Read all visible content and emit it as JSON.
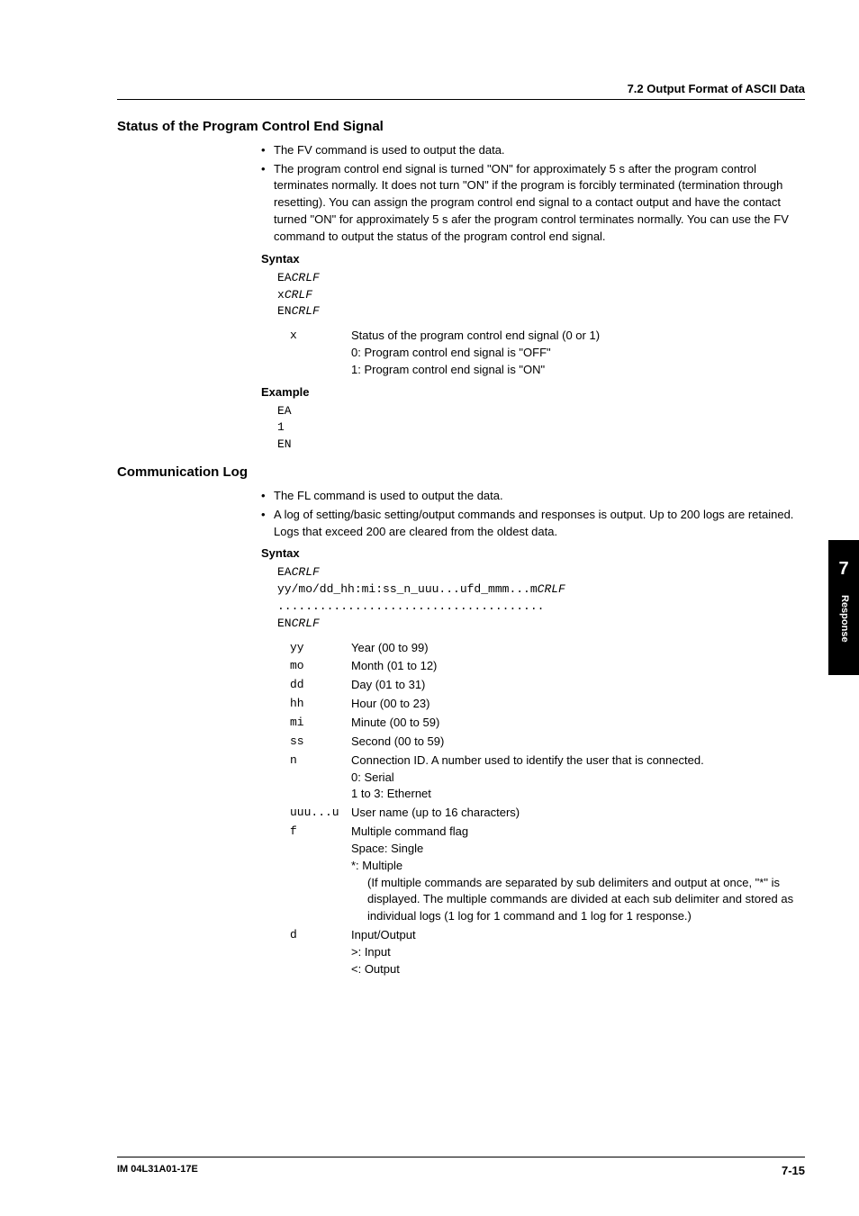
{
  "header": {
    "section": "7.2  Output Format of ASCII Data"
  },
  "sec1": {
    "title": "Status of the Program Control End Signal",
    "bullets": [
      "The FV  command is used to output the data.",
      "The program control end signal is turned \"ON\" for approximately 5 s after the program control terminates normally.  It does not turn \"ON\" if the program is forcibly terminated (termination through resetting).  You can assign the program control end signal to a contact output and have the contact turned \"ON\" for approximately 5 s afer the program control terminates normally.  You can use the FV command to output the status of the program control end signal."
    ],
    "syntax_label": "Syntax",
    "syntax_lines": {
      "l1a": "EA",
      "l1b": "CRLF",
      "l2a": "x",
      "l2b": "CRLF",
      "l3a": "EN",
      "l3b": "CRLF"
    },
    "params": [
      {
        "key": "x",
        "val": "Status of the program control end signal (0 or 1)",
        "sub": [
          "0: Program control end signal is \"OFF\"",
          "1: Program control end signal is \"ON\""
        ]
      }
    ],
    "example_label": "Example",
    "example_lines": [
      "EA",
      "1",
      "EN"
    ]
  },
  "sec2": {
    "title": "Communication Log",
    "bullets": [
      "The FL command is used to output the data.",
      "A log of setting/basic setting/output commands and responses is output.  Up to 200 logs are retained.  Logs that exceed 200 are cleared from the oldest data."
    ],
    "syntax_label": "Syntax",
    "syntax_lines": {
      "l1a": "EA",
      "l1b": "CRLF",
      "l2a": "yy/mo/dd_hh:mi:ss_n_uuu...ufd_mmm...m",
      "l2b": "CRLF",
      "l3": "......................................",
      "l4a": "EN",
      "l4b": "CRLF"
    },
    "params": [
      {
        "key": "yy",
        "val": "Year (00 to 99)"
      },
      {
        "key": "mo",
        "val": "Month (01 to 12)"
      },
      {
        "key": "dd",
        "val": "Day (01 to 31)"
      },
      {
        "key": "hh",
        "val": "Hour (00 to 23)"
      },
      {
        "key": "mi",
        "val": "Minute (00 to 59)"
      },
      {
        "key": "ss",
        "val": "Second (00 to 59)"
      },
      {
        "key": "n",
        "val": "Connection ID.  A number used to identify the user that is connected.",
        "sub": [
          "0: Serial",
          "1 to 3: Ethernet"
        ]
      },
      {
        "key": "uuu...u",
        "val": "User name (up to 16 characters)"
      },
      {
        "key": "f",
        "val": "Multiple command flag",
        "sub": [
          "Space: Single",
          "*:  Multiple"
        ],
        "subsub": [
          "(If multiple commands are separated by sub delimiters and output at once, \"*\" is displayed.  The multiple commands are divided at each sub delimiter and stored as individual logs (1 log for 1 command and 1 log for 1 response.)"
        ]
      },
      {
        "key": "d",
        "val": "Input/Output",
        "sub": [
          ">: Input",
          "<: Output"
        ]
      }
    ]
  },
  "sidetab": {
    "num": "7",
    "text": "Response"
  },
  "footer": {
    "left": "IM 04L31A01-17E",
    "right": "7-15"
  }
}
